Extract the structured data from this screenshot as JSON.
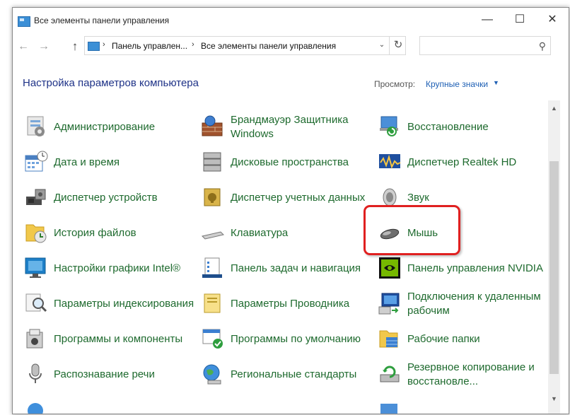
{
  "window": {
    "title": "Все элементы панели управления",
    "minimize": "—",
    "maximize": "☐",
    "close": "✕"
  },
  "nav": {
    "back": "←",
    "forward": "→",
    "up": "↑"
  },
  "address": {
    "crumbs": [
      "Панель управлен...",
      "Все элементы панели управления"
    ],
    "separator": "›",
    "dropdown": "⌄",
    "refresh": "↻"
  },
  "search": {
    "placeholder": "",
    "icon": "⚲"
  },
  "header": {
    "title": "Настройка параметров компьютера",
    "view_label": "Просмотр:",
    "view_value": "Крупные значки",
    "view_arrow": "▼"
  },
  "scroll": {
    "up": "▲",
    "down": "▼"
  },
  "items": [
    {
      "label": "Администрирование",
      "icon": "admin-tools-icon"
    },
    {
      "label": "Брандмауэр Защитника Windows",
      "icon": "firewall-icon"
    },
    {
      "label": "Восстановление",
      "icon": "recovery-icon"
    },
    {
      "label": "Дата и время",
      "icon": "datetime-icon"
    },
    {
      "label": "Дисковые пространства",
      "icon": "storage-spaces-icon"
    },
    {
      "label": "Диспетчер Realtek HD",
      "icon": "realtek-icon"
    },
    {
      "label": "Диспетчер устройств",
      "icon": "device-manager-icon"
    },
    {
      "label": "Диспетчер учетных данных",
      "icon": "credential-manager-icon"
    },
    {
      "label": "Звук",
      "icon": "sound-icon"
    },
    {
      "label": "История файлов",
      "icon": "file-history-icon"
    },
    {
      "label": "Клавиатура",
      "icon": "keyboard-icon"
    },
    {
      "label": "Мышь",
      "icon": "mouse-icon"
    },
    {
      "label": "Настройки графики Intel®",
      "icon": "intel-graphics-icon"
    },
    {
      "label": "Панель задач и навигация",
      "icon": "taskbar-icon"
    },
    {
      "label": "Панель управления NVIDIA",
      "icon": "nvidia-icon"
    },
    {
      "label": "Параметры индексирования",
      "icon": "indexing-icon"
    },
    {
      "label": "Параметры Проводника",
      "icon": "explorer-options-icon"
    },
    {
      "label": "Подключения к удаленным рабочим",
      "icon": "remote-connections-icon"
    },
    {
      "label": "Программы и компоненты",
      "icon": "programs-icon"
    },
    {
      "label": "Программы по умолчанию",
      "icon": "default-programs-icon"
    },
    {
      "label": "Рабочие папки",
      "icon": "work-folders-icon"
    },
    {
      "label": "Распознавание речи",
      "icon": "speech-recognition-icon"
    },
    {
      "label": "Региональные стандарты",
      "icon": "region-icon"
    },
    {
      "label": "Резервное копирование и восстановле...",
      "icon": "backup-icon"
    }
  ],
  "colors": {
    "link_text": "#1e6a2e",
    "title_text": "#1e3287",
    "accent": "#1e5fb4",
    "highlight": "#e02020"
  }
}
